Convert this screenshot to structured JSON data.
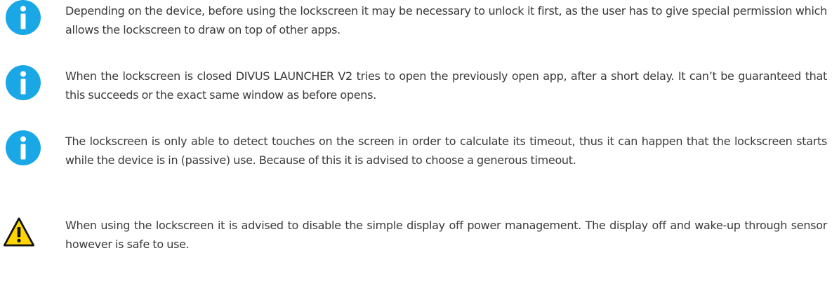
{
  "colors": {
    "info_icon": "#1aa7e6",
    "warning_icon": "#ffd400",
    "text": "#3a3a3a"
  },
  "notes": [
    {
      "icon": "info-icon",
      "text": "Depending on the device, before using the lockscreen it may be necessary to unlock it first, as the user has to give special permission which allows the lockscreen to draw on top of other apps."
    },
    {
      "icon": "info-icon",
      "text": "When the lockscreen is closed DIVUS LAUNCHER V2 tries to open the previously open app, after a short delay. It can’t be guaranteed that this succeeds or the exact same window as before opens."
    },
    {
      "icon": "info-icon",
      "text": "The lockscreen is only able to detect touches on the screen in order to calculate its timeout, thus it can happen that the lockscreen starts while the device is in (passive) use. Because of this it is advised to choose a generous timeout."
    },
    {
      "icon": "warning-icon",
      "text": "When using the lockscreen it is advised to disable the simple display off power management. The display off and wake-up through sensor however is safe to use."
    }
  ]
}
